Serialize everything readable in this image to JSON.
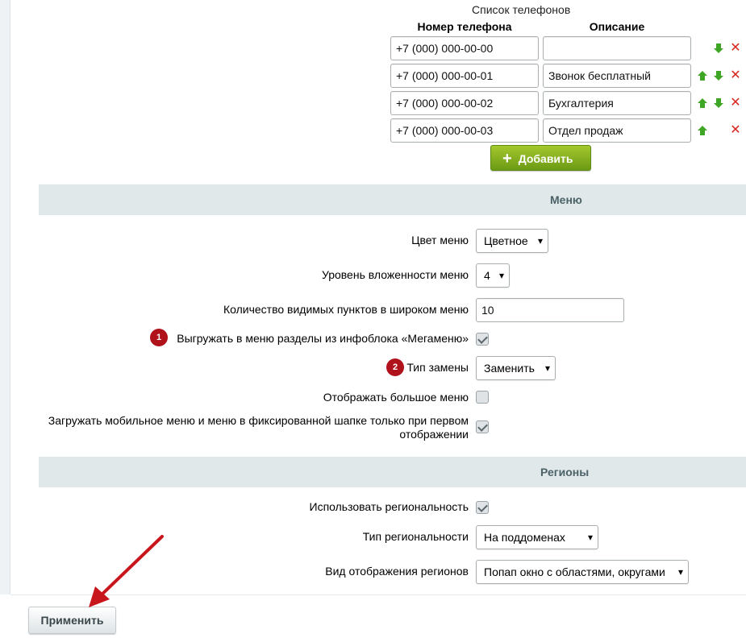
{
  "phones": {
    "caption": "Список телефонов",
    "col_number": "Номер телефона",
    "col_description": "Описание",
    "rows": [
      {
        "number": "+7 (000) 000-00-00",
        "description": ""
      },
      {
        "number": "+7 (000) 000-00-01",
        "description": "Звонок бесплатный"
      },
      {
        "number": "+7 (000) 000-00-02",
        "description": "Бухгалтерия"
      },
      {
        "number": "+7 (000) 000-00-03",
        "description": "Отдел продаж"
      }
    ],
    "add_button": "Добавить"
  },
  "menu": {
    "section_title": "Меню",
    "color_label": "Цвет меню",
    "color_value": "Цветное",
    "depth_label": "Уровень вложенности меню",
    "depth_value": "4",
    "visible_count_label": "Количество видимых пунктов в широком меню",
    "visible_count_value": "10",
    "megamenu_label": "Выгружать в меню разделы из инфоблока «Мегаменю»",
    "megamenu_badge": "1",
    "replace_type_label": "Тип замены",
    "replace_type_badge": "2",
    "replace_type_value": "Заменить",
    "big_menu_label": "Отображать большое меню",
    "mobile_menu_label_line1": "Загружать мобильное меню и меню в фиксированной шапке только при первом",
    "mobile_menu_label_line2": "отображении"
  },
  "regions": {
    "section_title": "Регионы",
    "use_regions_label": "Использовать региональность",
    "region_type_label": "Тип региональности",
    "region_type_value": "На поддоменах",
    "region_view_label": "Вид отображения регионов",
    "region_view_value": "Попап окно с областями, округами"
  },
  "footer": {
    "apply_button": "Применить"
  },
  "colors": {
    "add_button_green": "#7aa81b",
    "arrow_green": "#3fa524",
    "delete_red": "#d7261f",
    "badge_red": "#b0121b",
    "section_bar": "#e0e8ea",
    "annotation_arrow": "#c8161d"
  }
}
